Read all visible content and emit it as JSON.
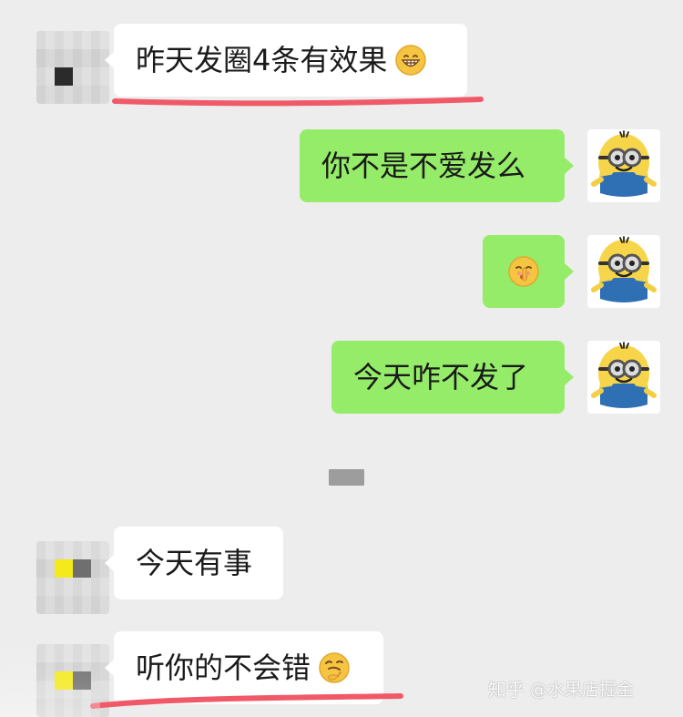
{
  "messages": [
    {
      "side": "left",
      "text": "昨天发圈4条有效果",
      "emoji": "grin-emoji"
    },
    {
      "side": "right",
      "text": "你不是不爱发么"
    },
    {
      "side": "right",
      "text": "",
      "emoji": "shush-emoji"
    },
    {
      "side": "right",
      "text": "今天咋不发了"
    },
    {
      "side": "left",
      "text": "今天有事"
    },
    {
      "side": "left",
      "text": "听你的不会错",
      "emoji": "thinking-emoji"
    }
  ],
  "watermark": {
    "brand": "知乎",
    "handle": "@水果店掘金"
  },
  "colors": {
    "background": "#ededed",
    "received_bubble": "#ffffff",
    "sent_bubble": "#95ec69",
    "underline": "#f05a68",
    "timestamp_placeholder": "#9d9d9d"
  },
  "icons": [
    "mosaic-avatar-icon",
    "minion-avatar-icon",
    "grin-emoji",
    "shush-emoji",
    "thinking-emoji"
  ]
}
